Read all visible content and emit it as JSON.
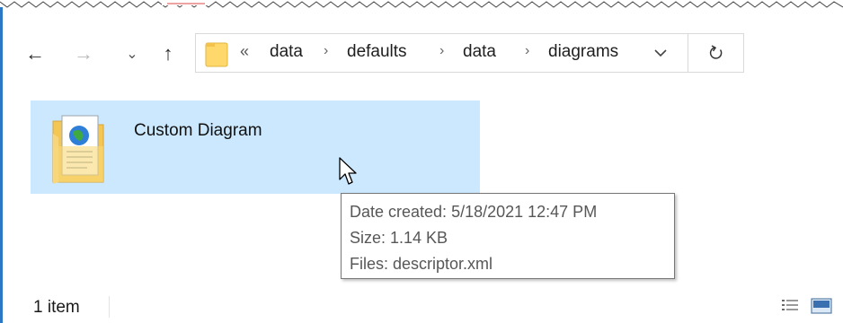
{
  "navigation": {
    "back": "←",
    "forward": "→",
    "recent": "⌄",
    "up": "↑"
  },
  "address_bar": {
    "overflow": "«",
    "crumbs": [
      "data",
      "defaults",
      "data",
      "diagrams"
    ],
    "separator": "›"
  },
  "item": {
    "name": "Custom Diagram"
  },
  "tooltip": {
    "date_created": "Date created: 5/18/2021 12:47 PM",
    "size": "Size: 1.14 KB",
    "files": "Files: descriptor.xml"
  },
  "status": {
    "item_count": "1 item"
  },
  "colors": {
    "selection": "#cce8ff",
    "accent": "#2b78c6",
    "folder": "#ffd86b"
  },
  "icons": [
    "back-arrow-icon",
    "forward-arrow-icon",
    "recent-locations-icon",
    "up-arrow-icon",
    "folder-icon",
    "chevron-down-icon",
    "refresh-icon",
    "folder-document-icon",
    "mouse-cursor-icon",
    "details-view-icon",
    "large-icons-view-icon"
  ]
}
